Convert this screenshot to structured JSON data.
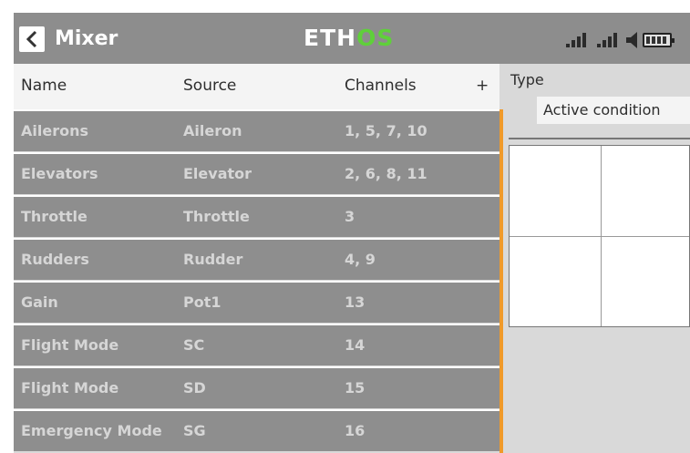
{
  "header": {
    "title": "Mixer",
    "logo_part1": "ETH",
    "logo_part2": "OS",
    "back_icon": "chevron-left-icon",
    "status_icons": [
      "signal-24-icon",
      "signal-900-icon",
      "speaker-icon",
      "battery-icon"
    ]
  },
  "table": {
    "columns": {
      "name": "Name",
      "source": "Source",
      "channels": "Channels",
      "add": "+"
    },
    "rows": [
      {
        "name": "Ailerons",
        "source": "Aileron",
        "channels": "1, 5, 7, 10"
      },
      {
        "name": "Elevators",
        "source": "Elevator",
        "channels": "2, 6, 8, 11"
      },
      {
        "name": "Throttle",
        "source": "Throttle",
        "channels": "3"
      },
      {
        "name": "Rudders",
        "source": "Rudder",
        "channels": "4, 9"
      },
      {
        "name": "Gain",
        "source": "Pot1",
        "channels": "13"
      },
      {
        "name": "Flight Mode",
        "source": "SC",
        "channels": "14"
      },
      {
        "name": "Flight Mode",
        "source": "SD",
        "channels": "15"
      },
      {
        "name": "Emergency Mode",
        "source": "SG",
        "channels": "16"
      }
    ]
  },
  "panel": {
    "type_label": "Type",
    "type_value": "Active condition"
  },
  "colors": {
    "header_bg": "#8d8d8d",
    "row_bg": "#8e8e8e",
    "accent_orange": "#f09a2a",
    "logo_green": "#5fd03a"
  }
}
